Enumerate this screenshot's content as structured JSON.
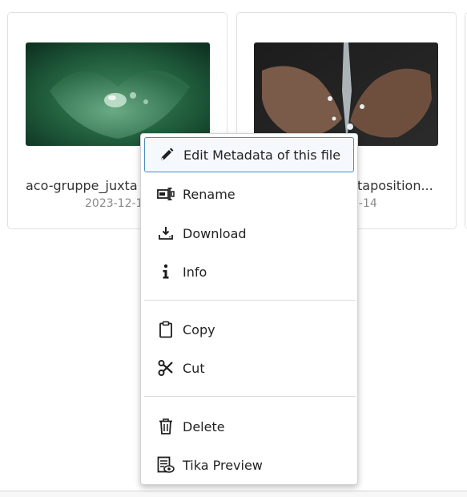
{
  "files": [
    {
      "name": "aco-gruppe_juxta",
      "date": "2023-12-1",
      "thumbnail_icon": "leaf-water-drop-image"
    },
    {
      "name": "taposition...",
      "date": "2-14",
      "thumbnail_icon": "hands-water-image"
    }
  ],
  "context_menu": {
    "items": [
      {
        "label": "Edit Metadata of this file",
        "icon": "pencil-icon",
        "active": true
      },
      {
        "label": "Rename",
        "icon": "rename-icon"
      },
      {
        "label": "Download",
        "icon": "download-icon"
      },
      {
        "label": "Info",
        "icon": "info-icon"
      },
      {
        "label": "Copy",
        "icon": "clipboard-icon"
      },
      {
        "label": "Cut",
        "icon": "scissors-icon"
      },
      {
        "label": "Delete",
        "icon": "trash-icon"
      },
      {
        "label": "Tika Preview",
        "icon": "tika-preview-icon"
      }
    ]
  },
  "colors": {
    "accent_border": "#4f8bbd",
    "menu_bg": "#ffffff",
    "date_text": "#8a8a8a"
  }
}
